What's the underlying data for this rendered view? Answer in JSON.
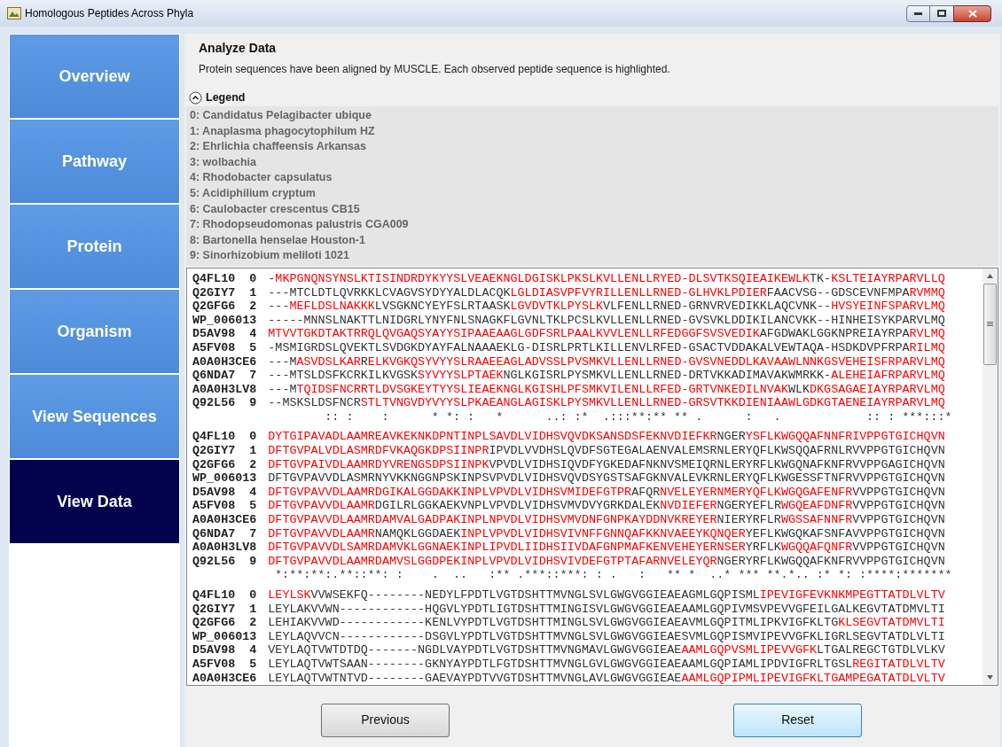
{
  "window": {
    "title": "Homologous Peptides Across Phyla"
  },
  "sidebar": {
    "items": [
      {
        "label": "Overview",
        "selected": false
      },
      {
        "label": "Pathway",
        "selected": false
      },
      {
        "label": "Protein",
        "selected": false
      },
      {
        "label": "Organism",
        "selected": false
      },
      {
        "label": "View Sequences",
        "selected": false
      },
      {
        "label": "View Data",
        "selected": true
      }
    ]
  },
  "header": {
    "title": "Analyze Data",
    "description": "Protein sequences have been aligned by MUSCLE. Each observed peptide sequence is highlighted."
  },
  "legend": {
    "title": "Legend",
    "expanded": true,
    "items": [
      "0: Candidatus Pelagibacter ubique",
      "1: Anaplasma phagocytophilum HZ",
      "2: Ehrlichia chaffeensis Arkansas",
      "3: wolbachia",
      "4: Rhodobacter capsulatus",
      "5: Acidiphilium cryptum",
      "6: Caulobacter crescentus CB15",
      "7: Rhodopseudomonas palustris CGA009",
      "8: Bartonella henselae Houston-1",
      "9: Sinorhizobium meliloti 1021"
    ]
  },
  "alignment": {
    "blocks": [
      {
        "rows": [
          {
            "id": "Q4FL10",
            "index": "0",
            "segments": [
              {
                "text": "-",
                "highlighted": false
              },
              {
                "text": "MKPGNQNSYNSLKTISINDRDYKYYSLVEAEKNGLDGISKLPKSLKVLLENLLRYED-DLSVTKSQIEAIKEWLK",
                "highlighted": true
              },
              {
                "text": "TK-",
                "highlighted": false
              },
              {
                "text": "KSLTEIAYRPARVLLQ",
                "highlighted": true
              }
            ]
          },
          {
            "id": "Q2GIY7",
            "index": "1",
            "segments": [
              {
                "text": "---MTCLDTLQVRKKLCVAGVSYDYYALDLACQK",
                "highlighted": false
              },
              {
                "text": "LGLDIASVPFVYRILLENLLRNED-GLHVKLPDIER",
                "highlighted": true
              },
              {
                "text": "FAACVSG--GDSCEVNFMPA",
                "highlighted": false
              },
              {
                "text": "RVMMQ",
                "highlighted": true
              }
            ]
          },
          {
            "id": "Q2GFG6",
            "index": "2",
            "segments": [
              {
                "text": "---",
                "highlighted": false
              },
              {
                "text": "MEFLDSLNAKKK",
                "highlighted": true
              },
              {
                "text": "LVSGKNCYEYFSLRTAASK",
                "highlighted": false
              },
              {
                "text": "LGVDVTKLPYSLK",
                "highlighted": true
              },
              {
                "text": "VLFENLLRNED-GRNVRVEDIKKLAQCVNK--",
                "highlighted": false
              },
              {
                "text": "HVSYEINFSPARVLMQ",
                "highlighted": true
              }
            ]
          },
          {
            "id": "WP_00601",
            "index": "3",
            "segments": [
              {
                "text": "-----MNNSLNAKTTLNIDGRLYNYFNLSNAGKFLGVNLTKLPCSLKVLLENLLRNED-GVSVKLDDIKILANCVKK--HINHEISYKPARVLMQ",
                "highlighted": false
              }
            ]
          },
          {
            "id": "D5AV98",
            "index": "4",
            "segments": [
              {
                "text": "MTVVTGKDTAKTRRQLQVGAQSYAYYSIPAAEAAGLGDFSRLPAALKVVLENLLRFEDGGFSVSVEDIK",
                "highlighted": true
              },
              {
                "text": "AFGDWAKLGGKNPREIAYRPA",
                "highlighted": false
              },
              {
                "text": "RVLMQ",
                "highlighted": true
              }
            ]
          },
          {
            "id": "A5FV08",
            "index": "5",
            "segments": [
              {
                "text": "-MSMIGRDSLQVEKTLSVDGKDYAYFALNAAAEKLG-DISRLPRTLKILLENVLRFED-GSACTVDDAKALVEWTAQA-HSDKDVPFRPA",
                "highlighted": false
              },
              {
                "text": "RILMQ",
                "highlighted": true
              }
            ]
          },
          {
            "id": "A0A0H3CE",
            "index": "6",
            "segments": [
              {
                "text": "---M",
                "highlighted": false
              },
              {
                "text": "ASVDSLKAR",
                "highlighted": true
              },
              {
                "text": "R",
                "highlighted": false
              },
              {
                "text": "ELKVGKQSYVYYSLRAAEEAGLADVSSLPVSMKVLLENLLRNED-GVSVNEDDLKAVAAWLNNKGSVEHEISFRPARVLMQ",
                "highlighted": true
              }
            ]
          },
          {
            "id": "Q6NDA7",
            "index": "7",
            "segments": [
              {
                "text": "---MTSLDSFKCRKILKVGSK",
                "highlighted": false
              },
              {
                "text": "SYVYYSLPTAEK",
                "highlighted": true
              },
              {
                "text": "NGLKGISRLPYSMKVLLENLLRNED-DRTVKKADIMAVAKWMRKK-",
                "highlighted": false
              },
              {
                "text": "ALEHEIAFRPARVLMQ",
                "highlighted": true
              }
            ]
          },
          {
            "id": "A0A0H3LV",
            "index": "8",
            "segments": [
              {
                "text": "---M",
                "highlighted": false
              },
              {
                "text": "TQIDSFNCRRTLDVSGKEYTYYSLIEAEKNGLKGISHLPFSMKVILENLLRFED-GRTVNKEDILNVAK",
                "highlighted": true
              },
              {
                "text": "WLK",
                "highlighted": false
              },
              {
                "text": "DKGSAGAEIAYRPARVLMQ",
                "highlighted": true
              }
            ]
          },
          {
            "id": "Q92L56",
            "index": "9",
            "segments": [
              {
                "text": "--MSKSLDSFNCR",
                "highlighted": false
              },
              {
                "text": "STLTVNGVDYVYYSLPKAEANGLAGISKLPYSMKVLLENLLRNED-GRSVTKKDIENIAAWLGDKGTAENEIAYRPARVLMQ",
                "highlighted": true
              }
            ]
          }
        ],
        "consensus": "       :: :    :      * *: :   *      ..: :*  .:::**:** ** .      :   .            :: : ***:::*"
      },
      {
        "rows": [
          {
            "id": "Q4FL10",
            "index": "0",
            "segments": [
              {
                "text": "DYTGIPAVADLAAMREAVKEKNKDPNTINPLSAVDLVIDHSVQVDKSANSDSFEKNVDIEFKR",
                "highlighted": true
              },
              {
                "text": "NGER",
                "highlighted": false
              },
              {
                "text": "YSFLKWGQQAFNNFRIVPPGTGICHQVN",
                "highlighted": true
              }
            ]
          },
          {
            "id": "Q2GIY7",
            "index": "1",
            "segments": [
              {
                "text": "DFTGVPALVDLASMRDFVKAQGKDPSIINPR",
                "highlighted": true
              },
              {
                "text": "IPVDLVVDHSLQVDFSGTEGALAENVALEMSRNLERYQFLKWSQQAFRNLRVVPPGTGICHQVN",
                "highlighted": false
              }
            ]
          },
          {
            "id": "Q2GFG6",
            "index": "2",
            "segments": [
              {
                "text": "DFTGVPAIVDLAAMRDYVRENGSDPSIINPK",
                "highlighted": true
              },
              {
                "text": "VPVDLVIDHSIQVDFYGKEDAFNKNVSMEIQRNLERYRFLKWGQNAFKNFRVVPPGAGICHQVN",
                "highlighted": false
              }
            ]
          },
          {
            "id": "WP_00601",
            "index": "3",
            "segments": [
              {
                "text": "DFTGVPAVVDLASMRNYVKKNGGNPSKINPSVPVDLVIDHSVQVDSYGSTSAFGKNVALEVKRNLERYQFLKWGESSFTNFRVVPPGTGICHQVN",
                "highlighted": false
              }
            ]
          },
          {
            "id": "D5AV98",
            "index": "4",
            "segments": [
              {
                "text": "DFTGVPAVVDLAAMRDGIKALGGDAKKINPLVPVDLVIDHSVMIDEFGTPR",
                "highlighted": true
              },
              {
                "text": "AFQR",
                "highlighted": false
              },
              {
                "text": "NVELEYERNMERYQFLKWGQGAFENFR",
                "highlighted": true
              },
              {
                "text": "VVPPGTGICHQVN",
                "highlighted": false
              }
            ]
          },
          {
            "id": "A5FV08",
            "index": "5",
            "segments": [
              {
                "text": "DFTGVPAVVDLAAMR",
                "highlighted": true
              },
              {
                "text": "DGILRLGGKAEKVNPLVPVDLVIDHSVMVDVYGRKDALEK",
                "highlighted": false
              },
              {
                "text": "NVDIEFER",
                "highlighted": true
              },
              {
                "text": "NGERYEFLR",
                "highlighted": false
              },
              {
                "text": "WGQEAFDNFR",
                "highlighted": true
              },
              {
                "text": "VVPPGTGICHQVN",
                "highlighted": false
              }
            ]
          },
          {
            "id": "A0A0H3CE",
            "index": "6",
            "segments": [
              {
                "text": "DFTGVPAVVDLAAMRDAMVALGADPAKINPLNPVDLVIDHSVMVDNFGNPKAYDDNVKREYER",
                "highlighted": true
              },
              {
                "text": "NIERYRFLR",
                "highlighted": false
              },
              {
                "text": "WGSSAFNNFR",
                "highlighted": true
              },
              {
                "text": "VVPPGTGICHQVN",
                "highlighted": false
              }
            ]
          },
          {
            "id": "Q6NDA7",
            "index": "7",
            "segments": [
              {
                "text": "DFTGVPAVVDLAAMR",
                "highlighted": true
              },
              {
                "text": "NAMQKLGGDAEK",
                "highlighted": false
              },
              {
                "text": "INPLVPVDLVIDHSVIVNFFGNNQAFKKNVAEEYKQNQER",
                "highlighted": true
              },
              {
                "text": "YEFLKWGQKAFSNFAVVPPGTGICHQVN",
                "highlighted": false
              }
            ]
          },
          {
            "id": "A0A0H3LV",
            "index": "8",
            "segments": [
              {
                "text": "DFTGVPAVVDLSAMRDAMVKLGGNAEKINPLIPVDLIIDHSIIVDAFGNPMAFKENVEHEYERNSER",
                "highlighted": true
              },
              {
                "text": "YRFLK",
                "highlighted": false
              },
              {
                "text": "WGQQAFQNFR",
                "highlighted": true
              },
              {
                "text": "VVPPGTGICHQVN",
                "highlighted": false
              }
            ]
          },
          {
            "id": "Q92L56",
            "index": "9",
            "segments": [
              {
                "text": "DFTGVPAVVDLAAMRDAMVSLGGDPEKINPLVPVDLVIDHSVIVDEFGTPTAFARNVELEYQR",
                "highlighted": true
              },
              {
                "text": "NGERYRFLKWGQQAFKNFRVVPPGTGICHQVN",
                "highlighted": false
              }
            ]
          }
        ],
        "consensus": "*:**:**:.**::**: :    .  ..   :** .***::***: : .   :   ** *  ..* *** **.*.. :* *: :****:*******"
      },
      {
        "rows": [
          {
            "id": "Q4FL10",
            "index": "0",
            "segments": [
              {
                "text": "LEYLSK",
                "highlighted": true
              },
              {
                "text": "VVWSEKFQ--------NEDYLFPDTLVGTDSHTTMVNGLSVLGWGVGGIEAEAGMLGQPISML",
                "highlighted": false
              },
              {
                "text": "IPEVIGFEVKNKMPEGTTATDLVLTV",
                "highlighted": true
              }
            ]
          },
          {
            "id": "Q2GIY7",
            "index": "1",
            "segments": [
              {
                "text": "LEYLAKVVWN------------HQGVLYPDTLIGTDSHTTMINGISVLGWGVGGIEAEAAMLGQPIVMSVPEVVGFEILGALKEGVTATDMVLTI",
                "highlighted": false
              }
            ]
          },
          {
            "id": "Q2GFG6",
            "index": "2",
            "segments": [
              {
                "text": "LEHIAKVVWD------------KENLVYPDTLVGTDSHTTMINGLSVLGWGVGGIEAEAVMLGQPITMLIPKVIGFKLTG",
                "highlighted": false
              },
              {
                "text": "KLSEGVTATDMVLTI",
                "highlighted": true
              }
            ]
          },
          {
            "id": "WP_00601",
            "index": "3",
            "segments": [
              {
                "text": "LEYLAQVVCN------------DSGVLYPDTLVGTDSHTTMVNGLSVLGWGVGGIEAESVMLGQPISMVIPEVVGFKLIGRLSEGVTATDLVLTI",
                "highlighted": false
              }
            ]
          },
          {
            "id": "D5AV98",
            "index": "4",
            "segments": [
              {
                "text": "VEYLAQTVWTDTDQ-------NGDLVAYPDTLVGTDSHTTMVNGMAVLGWGVGGIEAE",
                "highlighted": false
              },
              {
                "text": "AAMLGQPVSMLIPEVVGFK",
                "highlighted": true
              },
              {
                "text": "LTGALREGCTGTDLVLKV",
                "highlighted": false
              }
            ]
          },
          {
            "id": "A5FV08",
            "index": "5",
            "segments": [
              {
                "text": "LEYLAQTVWTSAAN--------GKNYAYPDTLFGTDSHTTMVNGLGVLGWGVGGIEAEAAMLGQPIAMLIPDVIGFRLTGSL",
                "highlighted": false
              },
              {
                "text": "REGITATDLVLTV",
                "highlighted": true
              }
            ]
          },
          {
            "id": "A0A0H3CE",
            "index": "6",
            "segments": [
              {
                "text": "LEYLAQTVWTNTVD--------GAEVAYPDTVVGTDSHTTMVNGLAVLGWGVGGIEAE",
                "highlighted": false
              },
              {
                "text": "AAMLGQPIPMLIPEVIGFKLTGAMPEGATATDLVLTV",
                "highlighted": true
              }
            ]
          }
        ]
      }
    ]
  },
  "buttons": [
    {
      "label": "Previous",
      "focused": false
    },
    {
      "label": "Reset",
      "focused": true
    }
  ]
}
